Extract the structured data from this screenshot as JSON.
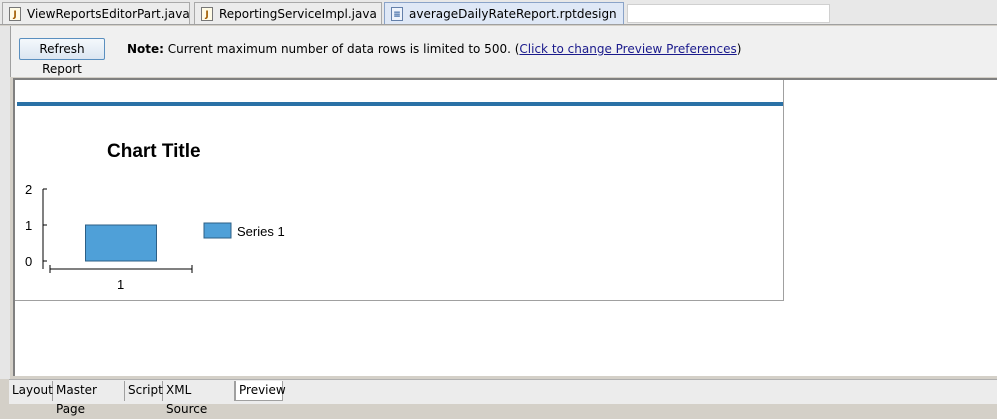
{
  "editor_tabs": [
    {
      "label": "ViewReportsEditorPart.java",
      "icon": "java-file-icon"
    },
    {
      "label": "ReportingServiceImpl.java",
      "icon": "java-file-icon"
    },
    {
      "label": "averageDailyRateReport.rptdesign",
      "icon": "report-design-icon",
      "active": true
    }
  ],
  "toolbar": {
    "refresh_label": "Refresh Report",
    "note_bold": "Note:",
    "note_text": " Current maximum number of data rows is limited to 500. (",
    "note_link": "Click to change Preview Preferences",
    "note_end": ")"
  },
  "chart_data": {
    "type": "bar",
    "title": "Chart Title",
    "categories": [
      "1"
    ],
    "series": [
      {
        "name": "Series 1",
        "values": [
          1
        ]
      }
    ],
    "ylim": [
      0,
      2
    ],
    "yticks": [
      0,
      1,
      2
    ],
    "legend": "right",
    "grid": false,
    "bar_color": "#4fa0d8"
  },
  "bottom_tabs": [
    {
      "label": "Layout"
    },
    {
      "label": "Master Page"
    },
    {
      "label": "Script"
    },
    {
      "label": "XML Source"
    },
    {
      "label": "Preview",
      "active": true
    }
  ],
  "colors": {
    "accent_bar": "#2a71a6"
  }
}
